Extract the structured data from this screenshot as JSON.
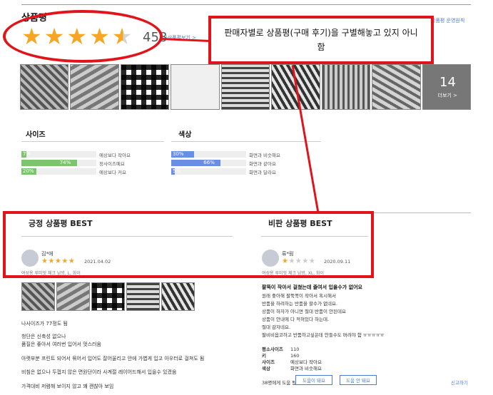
{
  "review_section": {
    "title": "상품평",
    "rating": 4.5,
    "rating_stars": "★★★★★",
    "review_count": "458",
    "see_all_link": "(상품평보기 >",
    "policy_link": "상품평 운영원칙"
  },
  "annotation": {
    "callout_text": "판매자별로 상품평(구매 후기)을 구별해놓고 있지 아니함",
    "color": "#e0151b"
  },
  "photos": {
    "more_count": "14",
    "more_label": "더보기 >"
  },
  "size_survey": {
    "title": "사이즈",
    "items": [
      {
        "pct_label": "7%",
        "value": 7,
        "label": "예상보다 작아요"
      },
      {
        "pct_label": "74%",
        "value": 74,
        "label": "정사이즈예요"
      },
      {
        "pct_label": "20%",
        "value": 20,
        "label": "예상보다 커요"
      }
    ],
    "color": "#7dc46e"
  },
  "color_survey": {
    "title": "색상",
    "items": [
      {
        "pct_label": "30%",
        "value": 30,
        "label": "화면과 비슷해요"
      },
      {
        "pct_label": "66%",
        "value": 66,
        "label": "화면과 같아요"
      },
      {
        "pct_label": "5%",
        "value": 5,
        "label": "화면과 달라요"
      }
    ],
    "color": "#6b8ee5"
  },
  "best_positive": {
    "title": "긍정 상품평 BEST",
    "user": "김*애",
    "stars": "★★★★★",
    "date": "2021.04.02",
    "option": "여성용 루미엇 체크 남방, L, 화이"
  },
  "best_negative": {
    "title": "비판 상품평 BEST",
    "user": "류*림",
    "stars_on": "★",
    "stars_off": "★★★★",
    "date": "2020.09.11",
    "option": "여성용 루미엇 체크 남방, XL, 화이"
  },
  "positive_body": [
    "나사이즈가 77정도 됨",
    "청단은 신축성 없으나",
    "품질은 좋아서 여러번 입어서 멋스러움",
    "아랫부분 프린트 되어서 묶어서 입어도 잘어울리고 안에 가볍게 입고 아우터로 걸쳐도 됨",
    "비침은 없으나 두껍지 않은 면원단이라 사계절 레이어드해서 입을수 있겠음",
    "가격대비 저렴해 보이지 않고 꽤 괜찮아 보임"
  ],
  "negative_review": {
    "headline": "팔뚝이 작아서 걸쳤는데 줄여서 입을수가 없어요",
    "lines": [
      "원래 좋아해 팔뚝쪽이 작아서 혹시해서",
      "반품을 하려하는 반품을 할수가 없네요.",
      "상품이 하자가 아니면 절대 반품이 안된데요",
      "상품이 안내에 다 적혀있다 하는데.",
      "절대 감자네요.",
      "팔비비옵코하고 반품하고싶은데 안들수도 버려야 함 ㅠㅠㅠㅠㅠ"
    ],
    "attrs": [
      {
        "k": "평소사이즈",
        "v": "110"
      },
      {
        "k": "키",
        "v": "160"
      },
      {
        "k": "사이즈",
        "v": "예상보다 작아요"
      },
      {
        "k": "색상",
        "v": "화면과 비슷해요"
      }
    ],
    "helpful_prompt": "38명에게 도움 됨",
    "helpful_yes": "도움이 돼요",
    "helpful_no": "도움 안 돼요",
    "report": "신고하기"
  }
}
